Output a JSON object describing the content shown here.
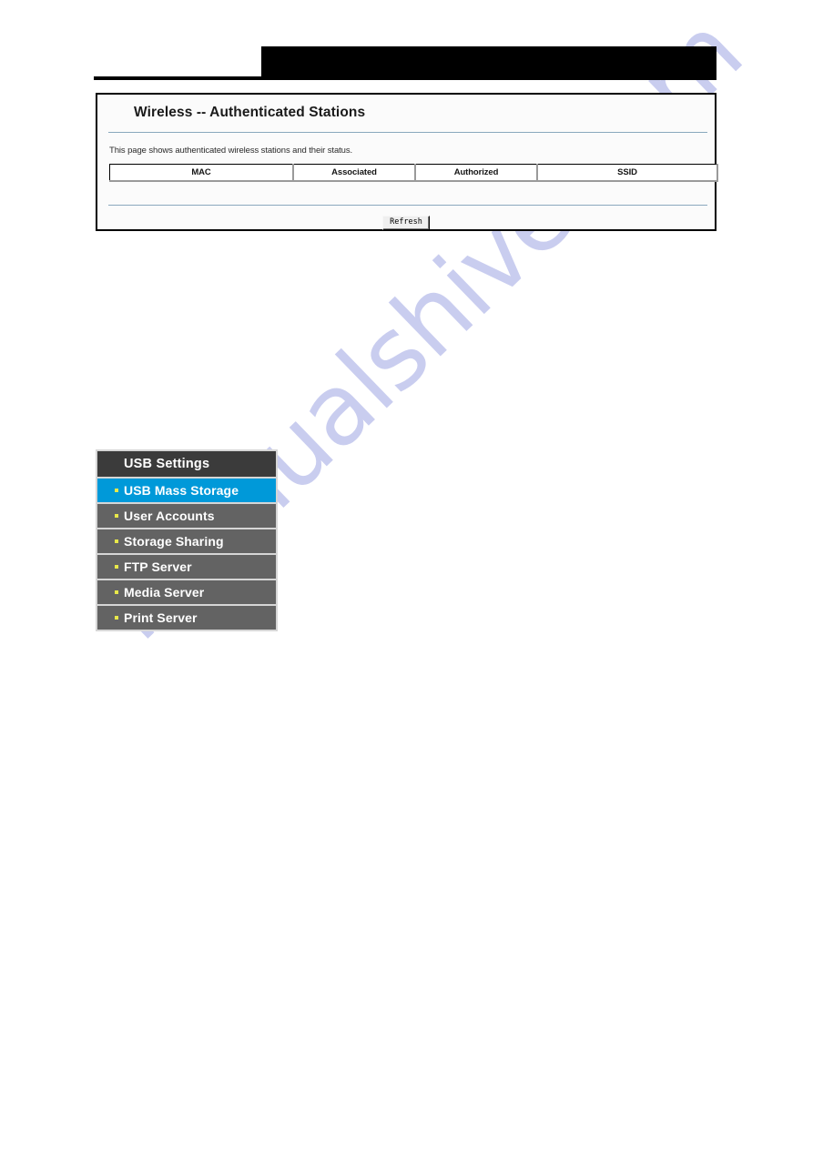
{
  "page": {
    "header": {
      "black_bar": "",
      "rule": ""
    }
  },
  "router_panel": {
    "title": "Wireless -- Authenticated Stations",
    "description": "This page shows authenticated wireless stations and their status.",
    "table": {
      "headers": [
        "MAC",
        "Associated",
        "Authorized",
        "SSID"
      ],
      "rows": []
    },
    "refresh_label": "Refresh"
  },
  "usb_menu": {
    "header": "USB Settings",
    "items": [
      {
        "label": "USB Mass Storage",
        "active": true
      },
      {
        "label": "User Accounts",
        "active": false
      },
      {
        "label": "Storage Sharing",
        "active": false
      },
      {
        "label": "FTP Server",
        "active": false
      },
      {
        "label": "Media Server",
        "active": false
      },
      {
        "label": "Print Server",
        "active": false
      }
    ]
  },
  "watermark": {
    "text": "manualshive.com",
    "color": "#c7cbef"
  },
  "colors": {
    "menu_header_bg": "#3b3b3b",
    "menu_item_bg": "#636363",
    "menu_active_bg": "#0099d9",
    "menu_bullet": "#e8e84a",
    "panel_rule": "#8aa8bd",
    "panel_border": "#000000"
  }
}
